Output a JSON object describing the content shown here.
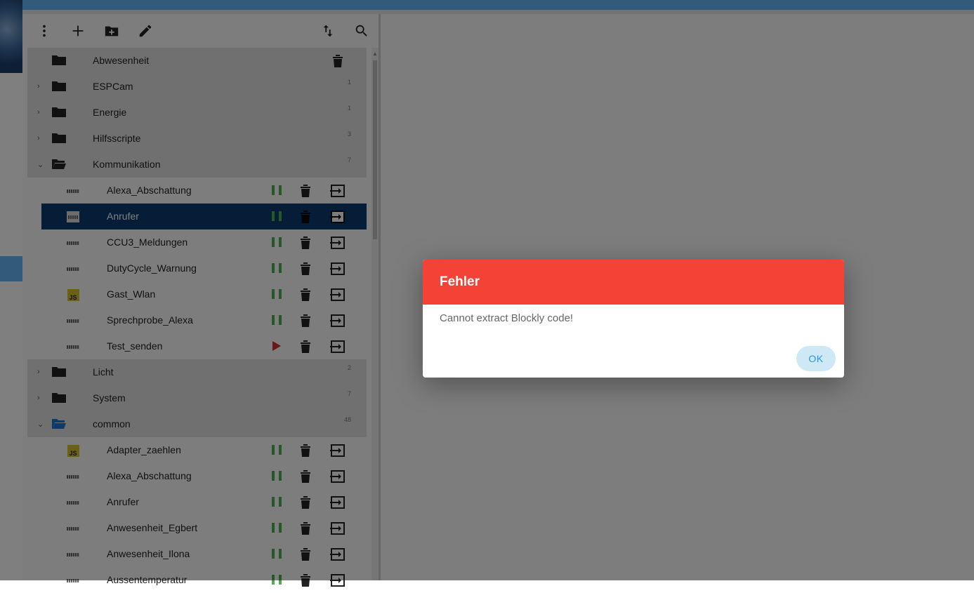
{
  "toolbar": {
    "icons": [
      "more-vert-icon",
      "add-icon",
      "add-folder-icon",
      "edit-icon",
      "sort-icon",
      "search-icon"
    ]
  },
  "tree": [
    {
      "type": "folder",
      "label": "Abwesenheit",
      "expanded": false,
      "count": "",
      "has_delete": true,
      "chevron": false
    },
    {
      "type": "folder",
      "label": "ESPCam",
      "expanded": false,
      "count": "1",
      "chevron": true
    },
    {
      "type": "folder",
      "label": "Energie",
      "expanded": false,
      "count": "1",
      "chevron": true
    },
    {
      "type": "folder",
      "label": "Hilfsscripte",
      "expanded": false,
      "count": "3",
      "chevron": true
    },
    {
      "type": "folder",
      "label": "Kommunikation",
      "expanded": true,
      "count": "7",
      "chevron": true
    },
    {
      "type": "script",
      "label": "Alexa_Abschattung",
      "kind": "blockly",
      "state": "running"
    },
    {
      "type": "script",
      "label": "Anrufer",
      "kind": "blockly",
      "state": "running",
      "selected": true
    },
    {
      "type": "script",
      "label": "CCU3_Meldungen",
      "kind": "blockly",
      "state": "running"
    },
    {
      "type": "script",
      "label": "DutyCycle_Warnung",
      "kind": "blockly",
      "state": "running"
    },
    {
      "type": "script",
      "label": "Gast_Wlan",
      "kind": "js",
      "state": "running"
    },
    {
      "type": "script",
      "label": "Sprechprobe_Alexa",
      "kind": "blockly",
      "state": "running"
    },
    {
      "type": "script",
      "label": "Test_senden",
      "kind": "blockly",
      "state": "stopped"
    },
    {
      "type": "folder",
      "label": "Licht",
      "expanded": false,
      "count": "2",
      "chevron": true
    },
    {
      "type": "folder",
      "label": "System",
      "expanded": false,
      "count": "7",
      "chevron": true
    },
    {
      "type": "folder",
      "label": "common",
      "expanded": true,
      "count": "48",
      "chevron": true,
      "accent": "#1976d2"
    },
    {
      "type": "script",
      "label": "Adapter_zaehlen",
      "kind": "js",
      "state": "running"
    },
    {
      "type": "script",
      "label": "Alexa_Abschattung",
      "kind": "blockly",
      "state": "running"
    },
    {
      "type": "script",
      "label": "Anrufer",
      "kind": "blockly",
      "state": "running"
    },
    {
      "type": "script",
      "label": "Anwesenheit_Egbert",
      "kind": "blockly",
      "state": "running"
    },
    {
      "type": "script",
      "label": "Anwesenheit_Ilona",
      "kind": "blockly",
      "state": "running"
    },
    {
      "type": "script",
      "label": "Aussentemperatur",
      "kind": "blockly",
      "state": "running"
    }
  ],
  "js_badge": "JS",
  "dialog": {
    "title": "Fehler",
    "message": "Cannot extract Blockly code!",
    "ok_label": "OK",
    "header_color": "#f44336"
  }
}
